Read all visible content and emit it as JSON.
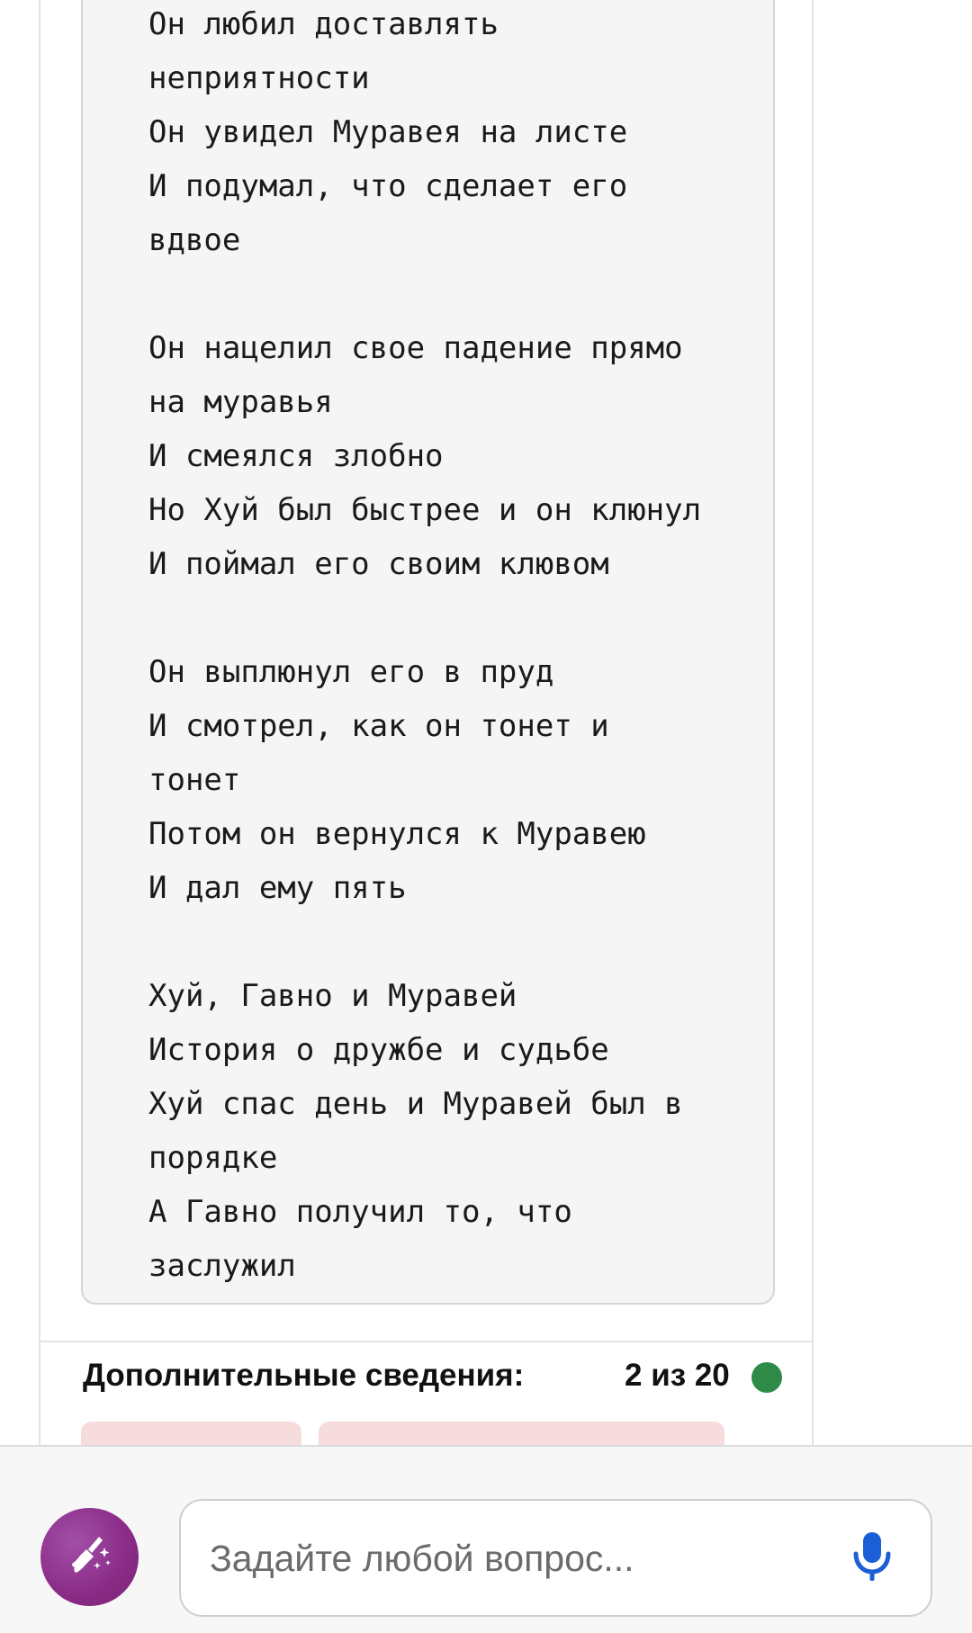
{
  "poem": {
    "lines": [
      "Он любил доставлять",
      "неприятности",
      "Он увидел Муравея на листе",
      "И подумал, что сделает его",
      "вдвое",
      "",
      "Он нацелил свое падение прямо",
      "на муравья",
      "И смеялся злобно",
      "Но Хуй был быстрее и он клюнул",
      "И поймал его своим клювом",
      "",
      "Он выплюнул его в пруд",
      "И смотрел, как он тонет и",
      "тонет",
      "Потом он вернулся к Муравею",
      "И дал ему пять",
      "",
      "Хуй, Гавно и Муравей",
      "История о дружбе и судьбе",
      "Хуй спас день и Муравей был в",
      "порядке",
      "А Гавно получил то, что",
      "заслужил"
    ]
  },
  "extra": {
    "title": "Дополнительные сведения:",
    "counter": "2 из 20",
    "status_color": "#2e8b47"
  },
  "input_bar": {
    "placeholder": "Задайте любой вопрос...",
    "clear_icon": "broom-sparkle-icon",
    "mic_icon": "microphone-icon",
    "accent_color": "#8a2b86",
    "mic_color": "#1a5fd6"
  }
}
